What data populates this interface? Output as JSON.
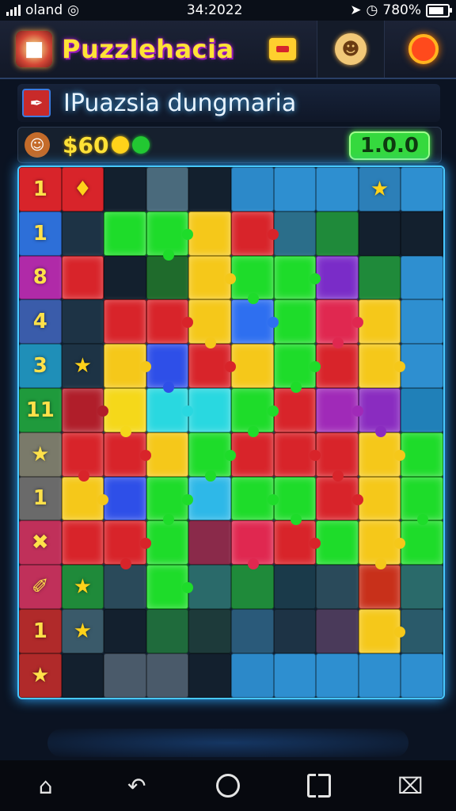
{
  "status_bar": {
    "carrier": "oland",
    "time": "34:2022",
    "battery": "780%"
  },
  "header": {
    "title": "Puzzlehacia"
  },
  "subtitle": "IPuazsia dungmaria",
  "score_bar": {
    "score": "$60",
    "level": "1.0.0"
  },
  "colors": {
    "accent": "#ffe336",
    "board_border": "#48c8ff",
    "level_green": "#35d93e"
  },
  "board": {
    "rows": [
      [
        {
          "c": "#d8242a",
          "t": "1"
        },
        {
          "c": "#d8242a",
          "t": "♦"
        },
        {
          "c": "#13202e"
        },
        {
          "c": "#4a6a7c"
        },
        {
          "c": "#13202e"
        },
        {
          "c": "#2c89c9"
        },
        {
          "c": "#2e8fd0"
        },
        {
          "c": "#2e8fd0"
        },
        {
          "c": "#2c7fb8",
          "t": "★"
        },
        {
          "c": "#2e8fd0"
        }
      ],
      [
        {
          "c": "#2d6fd8",
          "t": "1"
        },
        {
          "c": "#1d3345"
        },
        {
          "c": "#1edc2a",
          "g": 1
        },
        {
          "c": "#1edc2a",
          "g": 1
        },
        {
          "c": "#f5c81a",
          "g": 1
        },
        {
          "c": "#d8242a",
          "g": 1
        },
        {
          "c": "#2b6e8a"
        },
        {
          "c": "#1f8a3a"
        },
        {
          "c": "#13202e"
        },
        {
          "c": "#13202e"
        }
      ],
      [
        {
          "c": "#b02aa8",
          "t": "8"
        },
        {
          "c": "#d8242a",
          "g": 1
        },
        {
          "c": "#13202e"
        },
        {
          "c": "#1f6b2c"
        },
        {
          "c": "#f5c81a",
          "g": 1
        },
        {
          "c": "#1edc2a",
          "g": 1
        },
        {
          "c": "#1edc2a",
          "g": 1
        },
        {
          "c": "#7a2cc8",
          "g": 1
        },
        {
          "c": "#1f8a3a"
        },
        {
          "c": "#2e8fd0"
        }
      ],
      [
        {
          "c": "#3a5caa",
          "t": "4"
        },
        {
          "c": "#1d3345"
        },
        {
          "c": "#d8242a",
          "g": 1
        },
        {
          "c": "#d8242a",
          "g": 1
        },
        {
          "c": "#f5c81a",
          "g": 1
        },
        {
          "c": "#2e6ff0",
          "g": 1
        },
        {
          "c": "#1edc2a",
          "g": 1
        },
        {
          "c": "#e02850",
          "g": 1
        },
        {
          "c": "#f5c81a",
          "g": 1
        },
        {
          "c": "#2e8fd0"
        }
      ],
      [
        {
          "c": "#1f8fb8",
          "t": "3"
        },
        {
          "c": "#1d3345",
          "t": "★"
        },
        {
          "c": "#f5c81a",
          "g": 1
        },
        {
          "c": "#2e4fe8",
          "g": 1
        },
        {
          "c": "#d8242a",
          "g": 1
        },
        {
          "c": "#f5c81a",
          "g": 1
        },
        {
          "c": "#1edc2a",
          "g": 1
        },
        {
          "c": "#d8242a",
          "g": 1
        },
        {
          "c": "#f5c81a",
          "g": 1
        },
        {
          "c": "#2e8fd0"
        }
      ],
      [
        {
          "c": "#1f9a3c",
          "t": "11"
        },
        {
          "c": "#b01e2a",
          "g": 1
        },
        {
          "c": "#f5d81a",
          "g": 1
        },
        {
          "c": "#29d8e0",
          "g": 1
        },
        {
          "c": "#29d8e0",
          "g": 1
        },
        {
          "c": "#1edc2a",
          "g": 1
        },
        {
          "c": "#d8242a",
          "g": 1
        },
        {
          "c": "#a02ab8",
          "g": 1
        },
        {
          "c": "#8a2cc0",
          "g": 1
        },
        {
          "c": "#2080b8"
        }
      ],
      [
        {
          "c": "#7a7a6a",
          "t": "★"
        },
        {
          "c": "#d8242a",
          "g": 1
        },
        {
          "c": "#d8242a",
          "g": 1
        },
        {
          "c": "#f5c81a",
          "g": 1
        },
        {
          "c": "#1edc2a",
          "g": 1
        },
        {
          "c": "#d8242a",
          "g": 1
        },
        {
          "c": "#d8242a",
          "g": 1
        },
        {
          "c": "#d8242a",
          "g": 1
        },
        {
          "c": "#f5c81a",
          "g": 1
        },
        {
          "c": "#1edc2a",
          "g": 1
        }
      ],
      [
        {
          "c": "#6a6a6a",
          "t": "1"
        },
        {
          "c": "#f5c81a",
          "g": 1
        },
        {
          "c": "#2e4fe8",
          "g": 1
        },
        {
          "c": "#1edc2a",
          "g": 1
        },
        {
          "c": "#2eb8e8",
          "g": 1
        },
        {
          "c": "#1edc2a",
          "g": 1
        },
        {
          "c": "#1edc2a",
          "g": 1
        },
        {
          "c": "#d8242a",
          "g": 1
        },
        {
          "c": "#f5c81a",
          "g": 1
        },
        {
          "c": "#1edc2a",
          "g": 1
        }
      ],
      [
        {
          "c": "#c0305a",
          "t": "✖"
        },
        {
          "c": "#d8242a",
          "g": 1
        },
        {
          "c": "#d8242a",
          "g": 1
        },
        {
          "c": "#1edc2a",
          "g": 1
        },
        {
          "c": "#8a2a4a"
        },
        {
          "c": "#e02850",
          "g": 1
        },
        {
          "c": "#d8242a",
          "g": 1
        },
        {
          "c": "#1edc2a",
          "g": 1
        },
        {
          "c": "#f5c81a",
          "g": 1
        },
        {
          "c": "#1edc2a",
          "g": 1
        }
      ],
      [
        {
          "c": "#c0305a",
          "t": "✐"
        },
        {
          "c": "#1f8a3a",
          "t": "★"
        },
        {
          "c": "#2a4a5a"
        },
        {
          "c": "#1edc2a",
          "g": 1
        },
        {
          "c": "#2a6a6a"
        },
        {
          "c": "#1f8a3a"
        },
        {
          "c": "#1a3a4a"
        },
        {
          "c": "#2a4a5a"
        },
        {
          "c": "#c8301a",
          "g": 1
        },
        {
          "c": "#2a6a6a"
        }
      ],
      [
        {
          "c": "#b02a2a",
          "t": "1"
        },
        {
          "c": "#3a5a6a",
          "t": "★"
        },
        {
          "c": "#13202e"
        },
        {
          "c": "#1f6b3c"
        },
        {
          "c": "#1d3a3a"
        },
        {
          "c": "#2a5a7a"
        },
        {
          "c": "#1d3345"
        },
        {
          "c": "#4a3a5a"
        },
        {
          "c": "#f5c81a",
          "g": 1
        },
        {
          "c": "#2a5a6a"
        }
      ],
      [
        {
          "c": "#b02a2a",
          "t": "★"
        },
        {
          "c": "#13202e"
        },
        {
          "c": "#4a5a6a"
        },
        {
          "c": "#4a5a6a"
        },
        {
          "c": "#13202e"
        },
        {
          "c": "#2c89c9"
        },
        {
          "c": "#2e8fd0"
        },
        {
          "c": "#2e8fd0"
        },
        {
          "c": "#2e8fd0"
        },
        {
          "c": "#2e8fd0"
        }
      ]
    ]
  },
  "nav": {
    "home": "⌂",
    "back": "↶"
  }
}
